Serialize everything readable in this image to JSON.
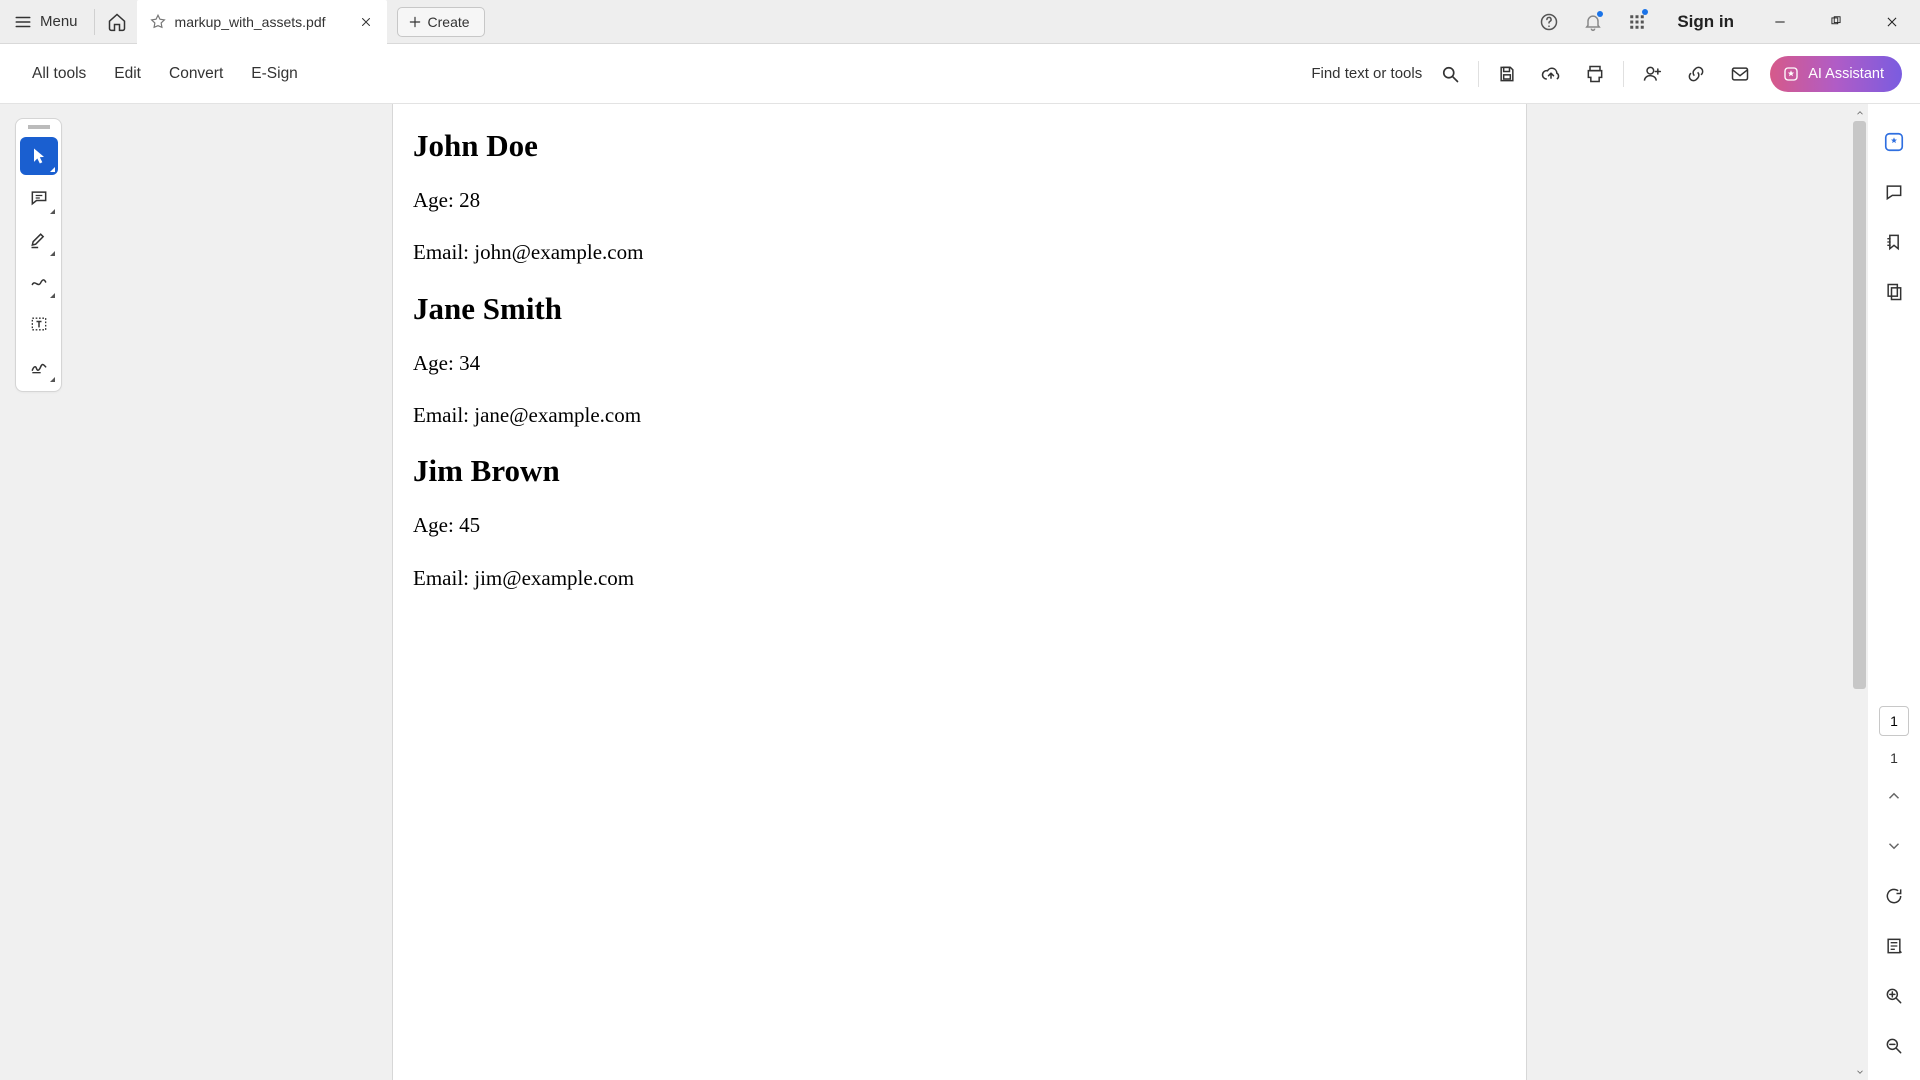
{
  "titlebar": {
    "menu_label": "Menu",
    "tab_title": "markup_with_assets.pdf",
    "create_label": "Create",
    "signin_label": "Sign in"
  },
  "toolbar": {
    "items": [
      "All tools",
      "Edit",
      "Convert",
      "E-Sign"
    ],
    "find_label": "Find text or tools",
    "ai_label": "AI Assistant"
  },
  "document": {
    "people": [
      {
        "name": "John Doe",
        "age_line": "Age: 28",
        "email_line": "Email: john@example.com"
      },
      {
        "name": "Jane Smith",
        "age_line": "Age: 34",
        "email_line": "Email: jane@example.com"
      },
      {
        "name": "Jim Brown",
        "age_line": "Age: 45",
        "email_line": "Email: jim@example.com"
      }
    ]
  },
  "nav": {
    "current_page": "1",
    "total_pages": "1"
  }
}
